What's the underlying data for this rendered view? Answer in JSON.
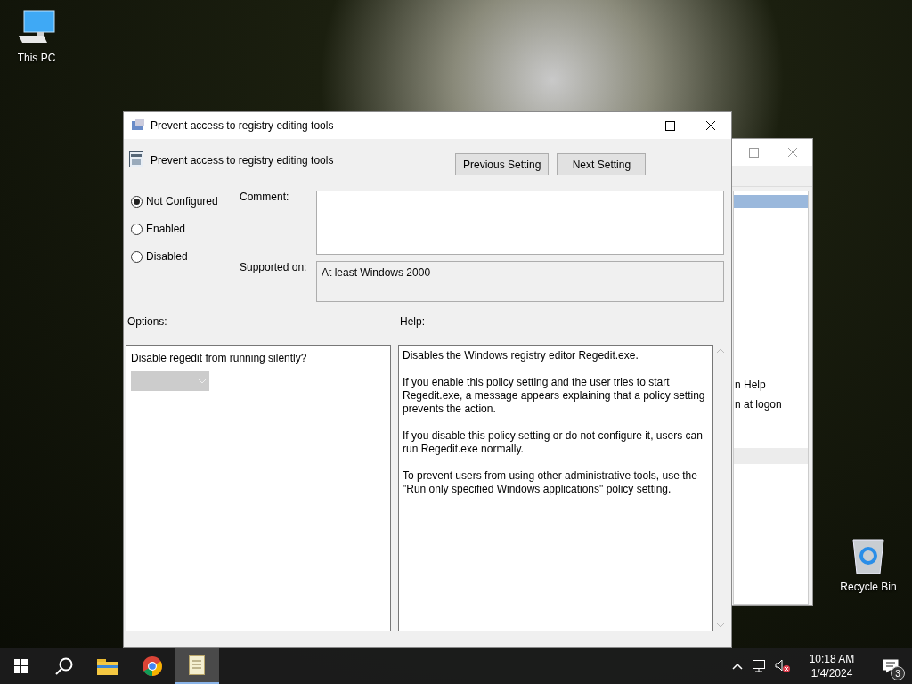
{
  "desktop_icons": [
    {
      "kind": "pc",
      "label": "This PC"
    },
    {
      "kind": "bin",
      "label": "Recycle Bin"
    }
  ],
  "background_window": {
    "lines": [
      "n Help",
      "n at logon"
    ]
  },
  "dialog": {
    "title": "Prevent access to registry editing tools",
    "setting_name": "Prevent access to registry editing tools",
    "nav_buttons": [
      "Previous Setting",
      "Next Setting"
    ],
    "states": [
      {
        "label": "Not Configured",
        "selected": true
      },
      {
        "label": "Enabled",
        "selected": false
      },
      {
        "label": "Disabled",
        "selected": false
      }
    ],
    "comment": {
      "label": "Comment:"
    },
    "supported_on": {
      "label": "Supported on:",
      "value": "At least Windows 2000"
    },
    "options": {
      "label": "Options:",
      "prompt": "Disable regedit from running silently?",
      "dropdown": {
        "disabled": true
      }
    },
    "help": {
      "label": "Help:",
      "paragraphs": [
        "Disables the Windows registry editor Regedit.exe.",
        "If you enable this policy setting and the user tries to start Regedit.exe, a message appears explaining that a policy setting prevents the action.",
        "If you disable this policy setting or do not configure it, users can run Regedit.exe normally.",
        "To prevent users from using other administrative tools, use the \"Run only specified Windows applications\" policy setting."
      ]
    }
  },
  "taskbar": {
    "apps": [
      {
        "kind": "explorer",
        "active": false
      },
      {
        "kind": "chrome",
        "active": false
      },
      {
        "kind": "notepad",
        "active": true
      }
    ],
    "clock": {
      "time": "10:18 AM",
      "date": "1/4/2024"
    },
    "notification_count": "3"
  }
}
